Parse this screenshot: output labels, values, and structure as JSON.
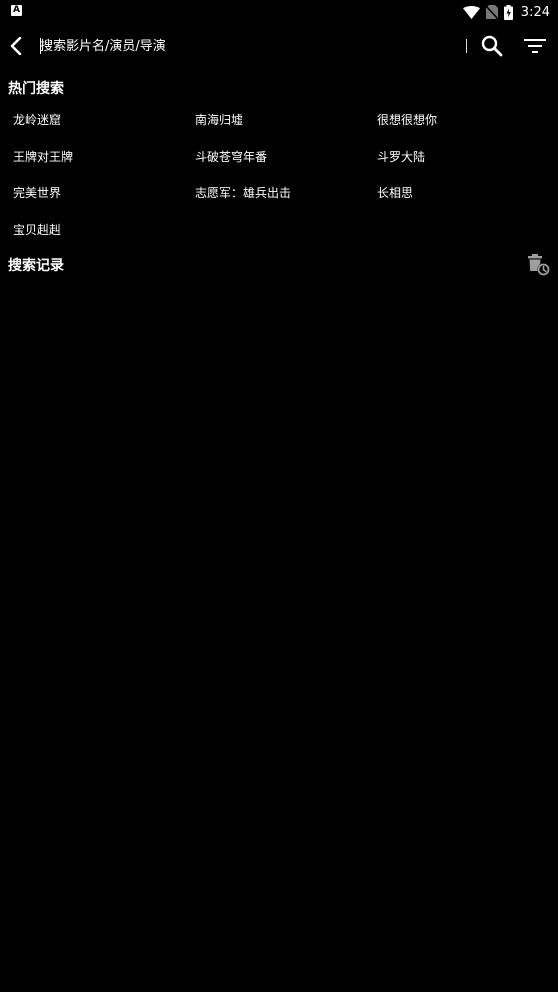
{
  "status_bar": {
    "left_icon_letter": "A",
    "time": "3:24",
    "icons": [
      "wifi-icon",
      "no-sim-icon",
      "battery-charging-icon"
    ]
  },
  "toolbar": {
    "back_icon": "back-arrow-icon",
    "search_placeholder": "搜索影片名/演员/导演",
    "search_value": "",
    "search_icon": "search-icon",
    "filter_icon": "filter-icon"
  },
  "hot_search": {
    "title": "热门搜索",
    "items": [
      "龙岭迷窟",
      "南海归墟",
      "很想很想你",
      "王牌对王牌",
      "斗破苍穹年番",
      "斗罗大陆",
      "完美世界",
      "志愿军：雄兵出击",
      "长相思",
      "宝贝赳赳"
    ]
  },
  "search_history": {
    "title": "搜索记录",
    "clear_icon": "delete-history-icon",
    "items": []
  },
  "colors": {
    "background": "#000000",
    "text": "#ffffff",
    "icon_gray": "#9e9e9e"
  }
}
